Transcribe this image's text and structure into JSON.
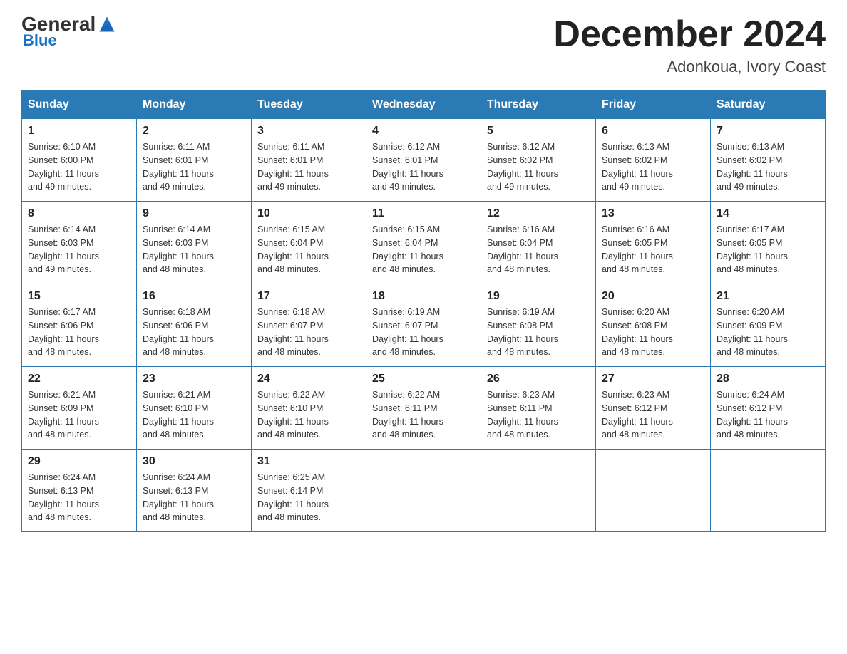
{
  "header": {
    "logo_general": "General",
    "logo_blue": "Blue",
    "month_title": "December 2024",
    "location": "Adonkoua, Ivory Coast"
  },
  "days_of_week": [
    "Sunday",
    "Monday",
    "Tuesday",
    "Wednesday",
    "Thursday",
    "Friday",
    "Saturday"
  ],
  "weeks": [
    [
      {
        "day": "1",
        "sunrise": "6:10 AM",
        "sunset": "6:00 PM",
        "daylight": "11 hours and 49 minutes."
      },
      {
        "day": "2",
        "sunrise": "6:11 AM",
        "sunset": "6:01 PM",
        "daylight": "11 hours and 49 minutes."
      },
      {
        "day": "3",
        "sunrise": "6:11 AM",
        "sunset": "6:01 PM",
        "daylight": "11 hours and 49 minutes."
      },
      {
        "day": "4",
        "sunrise": "6:12 AM",
        "sunset": "6:01 PM",
        "daylight": "11 hours and 49 minutes."
      },
      {
        "day": "5",
        "sunrise": "6:12 AM",
        "sunset": "6:02 PM",
        "daylight": "11 hours and 49 minutes."
      },
      {
        "day": "6",
        "sunrise": "6:13 AM",
        "sunset": "6:02 PM",
        "daylight": "11 hours and 49 minutes."
      },
      {
        "day": "7",
        "sunrise": "6:13 AM",
        "sunset": "6:02 PM",
        "daylight": "11 hours and 49 minutes."
      }
    ],
    [
      {
        "day": "8",
        "sunrise": "6:14 AM",
        "sunset": "6:03 PM",
        "daylight": "11 hours and 49 minutes."
      },
      {
        "day": "9",
        "sunrise": "6:14 AM",
        "sunset": "6:03 PM",
        "daylight": "11 hours and 48 minutes."
      },
      {
        "day": "10",
        "sunrise": "6:15 AM",
        "sunset": "6:04 PM",
        "daylight": "11 hours and 48 minutes."
      },
      {
        "day": "11",
        "sunrise": "6:15 AM",
        "sunset": "6:04 PM",
        "daylight": "11 hours and 48 minutes."
      },
      {
        "day": "12",
        "sunrise": "6:16 AM",
        "sunset": "6:04 PM",
        "daylight": "11 hours and 48 minutes."
      },
      {
        "day": "13",
        "sunrise": "6:16 AM",
        "sunset": "6:05 PM",
        "daylight": "11 hours and 48 minutes."
      },
      {
        "day": "14",
        "sunrise": "6:17 AM",
        "sunset": "6:05 PM",
        "daylight": "11 hours and 48 minutes."
      }
    ],
    [
      {
        "day": "15",
        "sunrise": "6:17 AM",
        "sunset": "6:06 PM",
        "daylight": "11 hours and 48 minutes."
      },
      {
        "day": "16",
        "sunrise": "6:18 AM",
        "sunset": "6:06 PM",
        "daylight": "11 hours and 48 minutes."
      },
      {
        "day": "17",
        "sunrise": "6:18 AM",
        "sunset": "6:07 PM",
        "daylight": "11 hours and 48 minutes."
      },
      {
        "day": "18",
        "sunrise": "6:19 AM",
        "sunset": "6:07 PM",
        "daylight": "11 hours and 48 minutes."
      },
      {
        "day": "19",
        "sunrise": "6:19 AM",
        "sunset": "6:08 PM",
        "daylight": "11 hours and 48 minutes."
      },
      {
        "day": "20",
        "sunrise": "6:20 AM",
        "sunset": "6:08 PM",
        "daylight": "11 hours and 48 minutes."
      },
      {
        "day": "21",
        "sunrise": "6:20 AM",
        "sunset": "6:09 PM",
        "daylight": "11 hours and 48 minutes."
      }
    ],
    [
      {
        "day": "22",
        "sunrise": "6:21 AM",
        "sunset": "6:09 PM",
        "daylight": "11 hours and 48 minutes."
      },
      {
        "day": "23",
        "sunrise": "6:21 AM",
        "sunset": "6:10 PM",
        "daylight": "11 hours and 48 minutes."
      },
      {
        "day": "24",
        "sunrise": "6:22 AM",
        "sunset": "6:10 PM",
        "daylight": "11 hours and 48 minutes."
      },
      {
        "day": "25",
        "sunrise": "6:22 AM",
        "sunset": "6:11 PM",
        "daylight": "11 hours and 48 minutes."
      },
      {
        "day": "26",
        "sunrise": "6:23 AM",
        "sunset": "6:11 PM",
        "daylight": "11 hours and 48 minutes."
      },
      {
        "day": "27",
        "sunrise": "6:23 AM",
        "sunset": "6:12 PM",
        "daylight": "11 hours and 48 minutes."
      },
      {
        "day": "28",
        "sunrise": "6:24 AM",
        "sunset": "6:12 PM",
        "daylight": "11 hours and 48 minutes."
      }
    ],
    [
      {
        "day": "29",
        "sunrise": "6:24 AM",
        "sunset": "6:13 PM",
        "daylight": "11 hours and 48 minutes."
      },
      {
        "day": "30",
        "sunrise": "6:24 AM",
        "sunset": "6:13 PM",
        "daylight": "11 hours and 48 minutes."
      },
      {
        "day": "31",
        "sunrise": "6:25 AM",
        "sunset": "6:14 PM",
        "daylight": "11 hours and 48 minutes."
      },
      null,
      null,
      null,
      null
    ]
  ],
  "labels": {
    "sunrise": "Sunrise:",
    "sunset": "Sunset:",
    "daylight": "Daylight:"
  }
}
